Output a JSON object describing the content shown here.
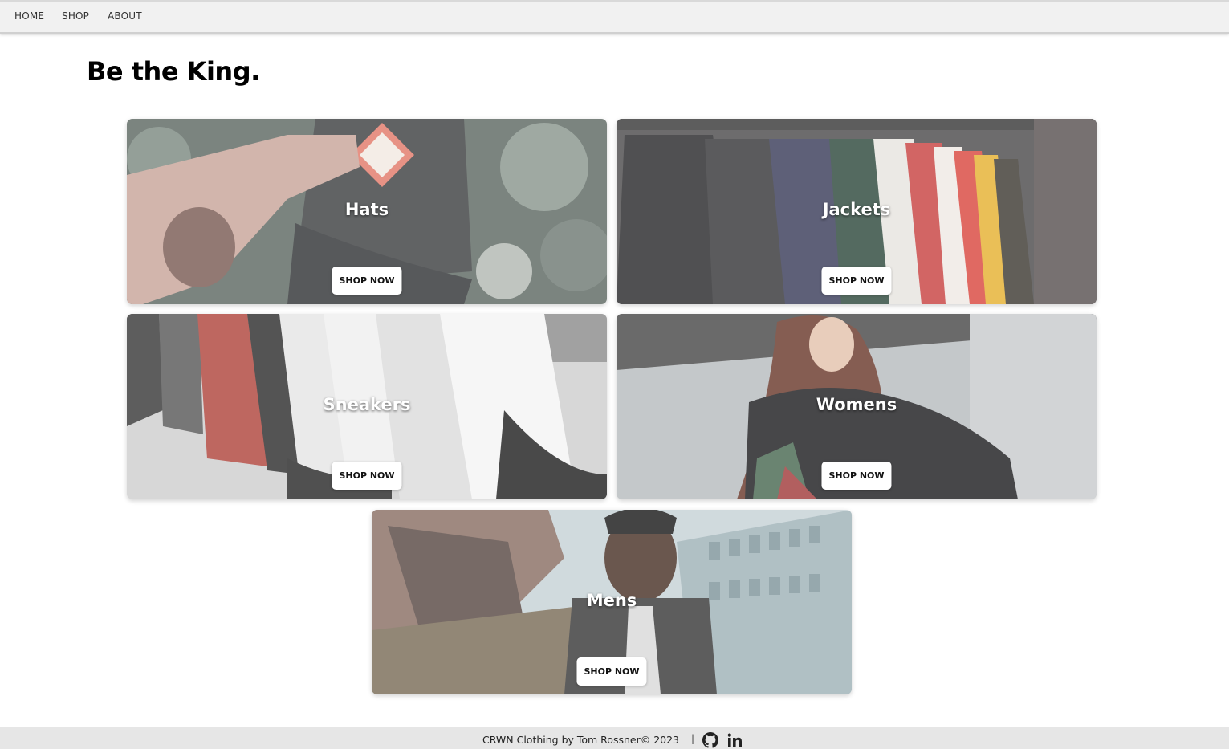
{
  "nav": {
    "home": "HOME",
    "shop": "SHOP",
    "about": "ABOUT"
  },
  "hero": {
    "title": "Be the King."
  },
  "categories": [
    {
      "title": "Hats",
      "button": "SHOP NOW"
    },
    {
      "title": "Jackets",
      "button": "SHOP NOW"
    },
    {
      "title": "Sneakers",
      "button": "SHOP NOW"
    },
    {
      "title": "Womens",
      "button": "SHOP NOW"
    },
    {
      "title": "Mens",
      "button": "SHOP NOW"
    }
  ],
  "footer": {
    "text": "CRWN Clothing by Tom Rossner© 2023",
    "separator": "|",
    "icons": [
      "github-icon",
      "linkedin-icon"
    ]
  },
  "colors": {
    "nav_bg": "#f1f1f1",
    "footer_bg": "#e6e6e6",
    "button_bg": "#ffffff",
    "title_text": "#000000"
  }
}
